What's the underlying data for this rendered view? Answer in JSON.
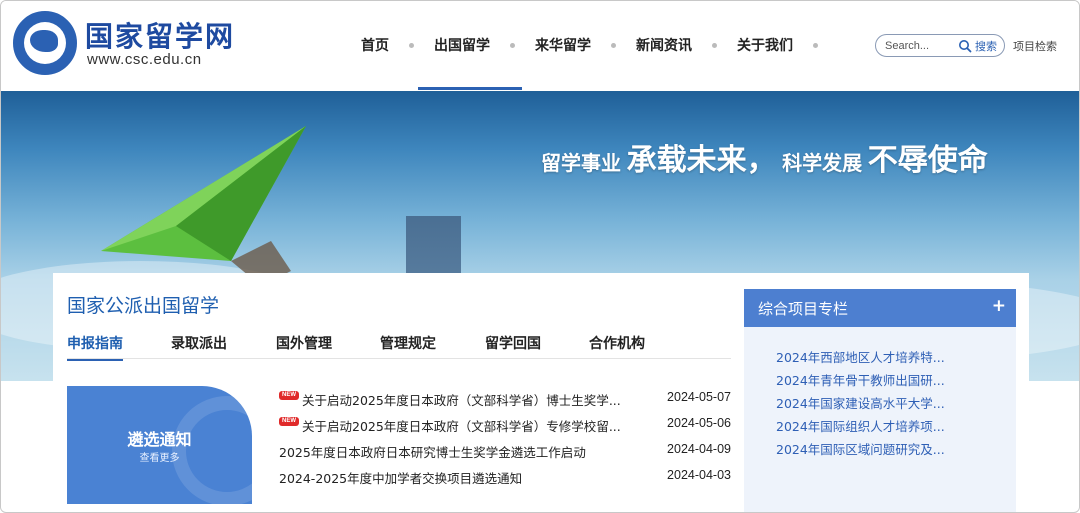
{
  "header": {
    "site_name": "国家留学网",
    "site_url": "www.csc.edu.cn",
    "nav": [
      {
        "label": "首页"
      },
      {
        "label": "出国留学"
      },
      {
        "label": "来华留学"
      },
      {
        "label": "新闻资讯"
      },
      {
        "label": "关于我们"
      }
    ],
    "active_nav": "出国留学",
    "search": {
      "placeholder": "Search...",
      "button_label": "搜索"
    },
    "item_search_label": "项目检索"
  },
  "banner": {
    "slogan_part1": "留学事业",
    "slogan_part2": "承载未来，",
    "slogan_part3": "科学发展",
    "slogan_part4": "不辱使命"
  },
  "main": {
    "section_title": "国家公派出国留学",
    "tabs": [
      {
        "label": "申报指南"
      },
      {
        "label": "录取派出"
      },
      {
        "label": "国外管理"
      },
      {
        "label": "管理规定"
      },
      {
        "label": "留学回国"
      },
      {
        "label": "合作机构"
      }
    ],
    "active_tab": "申报指南",
    "notice_card": {
      "title": "遴选通知",
      "more": "查看更多"
    },
    "new_badge": "NEW",
    "news": [
      {
        "title": "关于启动2025年度日本政府（文部科学省）博士生奖学...",
        "date": "2024-05-07",
        "is_new": true
      },
      {
        "title": "关于启动2025年度日本政府（文部科学省）专修学校留...",
        "date": "2024-05-06",
        "is_new": true
      },
      {
        "title": "2025年度日本政府日本研究博士生奖学金遴选工作启动",
        "date": "2024-04-09",
        "is_new": false
      },
      {
        "title": "2024-2025年度中加学者交换项目遴选通知",
        "date": "2024-04-03",
        "is_new": false
      }
    ]
  },
  "sidebar": {
    "title": "综合项目专栏",
    "plus": "+",
    "items": [
      {
        "label": "2024年西部地区人才培养特..."
      },
      {
        "label": "2024年青年骨干教师出国研..."
      },
      {
        "label": "2024年国家建设高水平大学..."
      },
      {
        "label": "2024年国际组织人才培养项..."
      },
      {
        "label": "2024年国际区域问题研究及..."
      }
    ]
  },
  "colors": {
    "brand": "#2b61b3",
    "title_blue": "#1f5fb0",
    "new_badge": "#e02a2a",
    "side_header": "#4d7fd0"
  }
}
